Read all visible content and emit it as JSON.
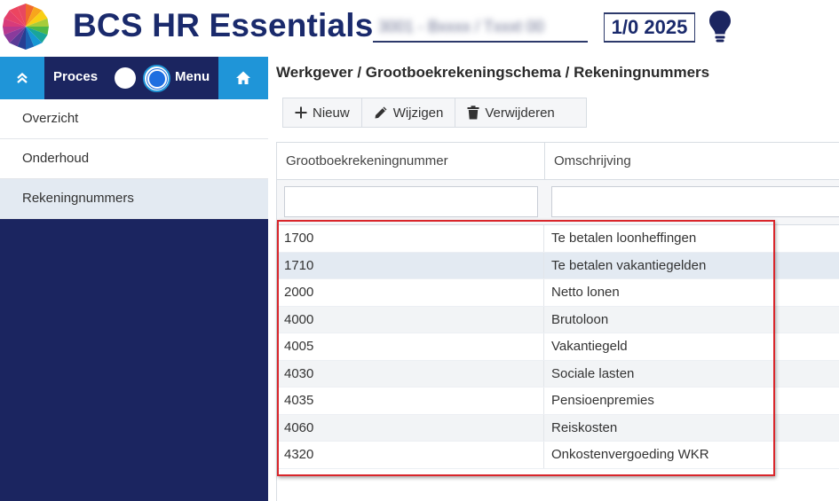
{
  "header": {
    "app_title": "BCS HR Essentials",
    "company_field_obscured": "3001 - Bxxxx / Txxxt 00",
    "period": "1/0 2025",
    "icons": {
      "logo": "bcs-logo-icon",
      "hint": "lightbulb-icon"
    }
  },
  "sidebar": {
    "toggle": {
      "proces_label": "Proces",
      "menu_label": "Menu",
      "selected": "Menu",
      "collapse_icon": "double-chevron-up-icon",
      "home_icon": "home-icon"
    },
    "items": [
      {
        "label": "Overzicht",
        "active": false
      },
      {
        "label": "Onderhoud",
        "active": false
      },
      {
        "label": "Rekeningnummers",
        "active": true
      }
    ]
  },
  "main": {
    "breadcrumb": "Werkgever / Grootboekrekeningschema / Rekeningnummers",
    "toolbar": {
      "new_label": "Nieuw",
      "edit_label": "Wijzigen",
      "delete_label": "Verwijderen"
    },
    "table": {
      "columns": [
        "Grootboekrekeningnummer",
        "Omschrijving"
      ],
      "filters": [
        "",
        ""
      ],
      "rows": [
        {
          "nummer": "1700",
          "omschrijving": "Te betalen loonheffingen"
        },
        {
          "nummer": "1710",
          "omschrijving": "Te betalen vakantiegelden"
        },
        {
          "nummer": "2000",
          "omschrijving": "Netto lonen"
        },
        {
          "nummer": "4000",
          "omschrijving": "Brutoloon"
        },
        {
          "nummer": "4005",
          "omschrijving": "Vakantiegeld"
        },
        {
          "nummer": "4030",
          "omschrijving": "Sociale lasten"
        },
        {
          "nummer": "4035",
          "omschrijving": "Pensioenpremies"
        },
        {
          "nummer": "4060",
          "omschrijving": "Reiskosten"
        },
        {
          "nummer": "4320",
          "omschrijving": "Onkostenvergoeding WKR"
        }
      ],
      "selected_row": 1
    }
  },
  "colors": {
    "navy": "#1b2560",
    "accent_blue": "#1f95d8",
    "title": "#1a2a6c",
    "highlight_box": "#d9262b"
  }
}
